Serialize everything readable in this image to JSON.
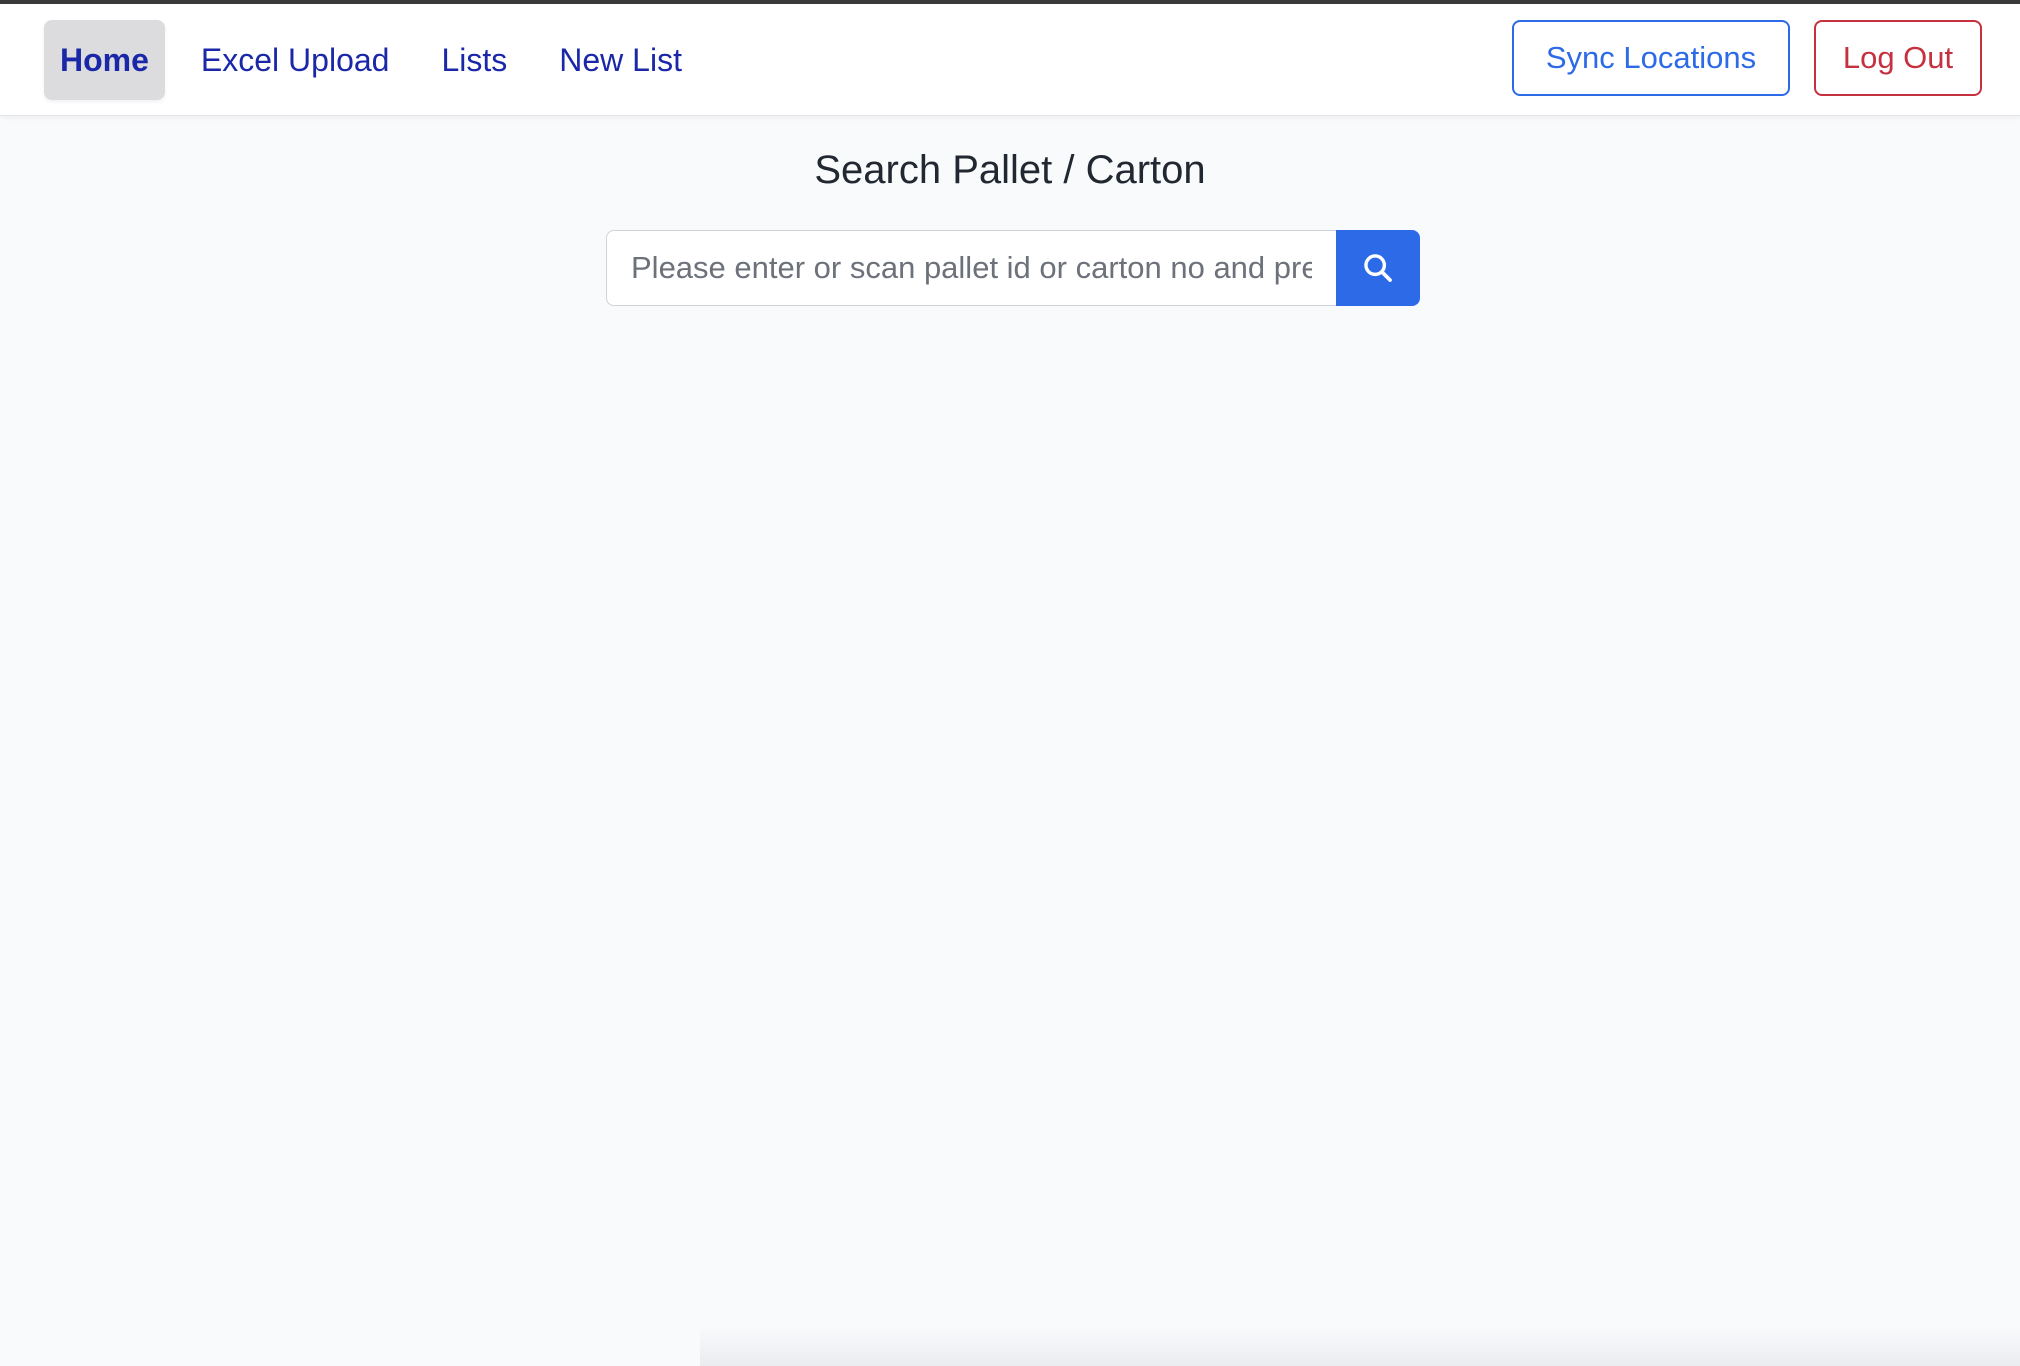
{
  "nav": {
    "links": [
      {
        "label": "Home",
        "active": true
      },
      {
        "label": "Excel Upload",
        "active": false
      },
      {
        "label": "Lists",
        "active": false
      },
      {
        "label": "New List",
        "active": false
      }
    ],
    "sync_label": "Sync Locations",
    "logout_label": "Log Out"
  },
  "main": {
    "title": "Search Pallet / Carton",
    "search": {
      "placeholder": "Please enter or scan pallet id or carton no and press enter",
      "value": "",
      "icon": "search-icon"
    }
  },
  "colors": {
    "nav_link": "#1a27a8",
    "primary": "#2d6ae8",
    "danger": "#c6313f",
    "active_bg": "#dcdcdf",
    "page_bg": "#f9fafc"
  }
}
